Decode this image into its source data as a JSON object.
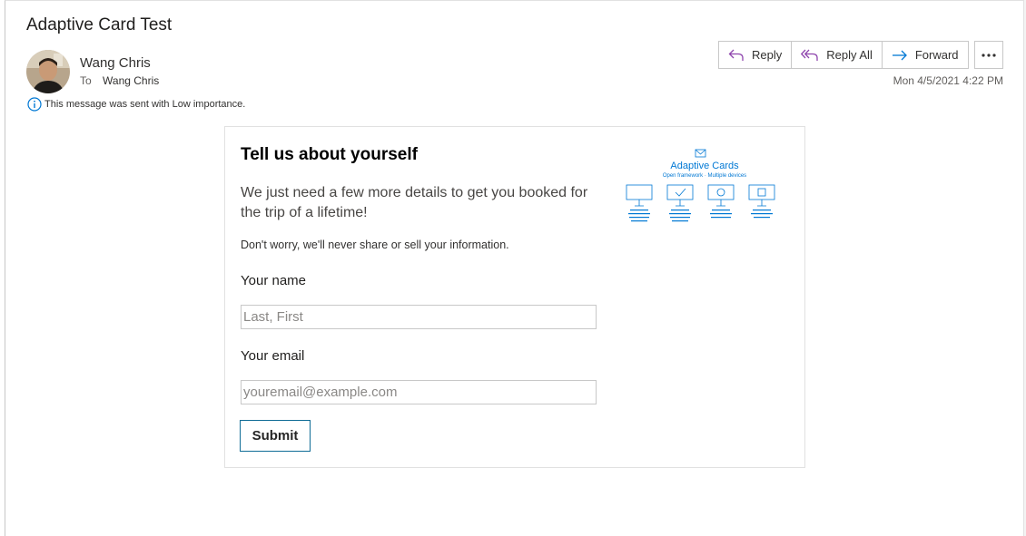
{
  "message": {
    "subject": "Adaptive Card Test",
    "sender": "Wang Chris",
    "to_label": "To",
    "to_name": "Wang Chris",
    "importance_note": "This message was sent with Low importance.",
    "timestamp": "Mon 4/5/2021 4:22 PM"
  },
  "toolbar": {
    "reply_label": "Reply",
    "reply_all_label": "Reply All",
    "forward_label": "Forward",
    "more_label": "•••"
  },
  "card": {
    "title": "Tell us about yourself",
    "subtitle": "We just need a few more details to get you booked for the trip of a lifetime!",
    "note": "Don't worry, we'll never share or sell your information.",
    "name_label": "Your name",
    "name_value": "",
    "name_placeholder": "Last, First",
    "email_label": "Your email",
    "email_value": "",
    "email_placeholder": "youremail@example.com",
    "submit_label": "Submit",
    "hero": {
      "title": "Adaptive Cards",
      "subtitle": "Open framework · Multiple devices"
    }
  },
  "colors": {
    "accent": "#0f6c96",
    "reply_icon": "#8e44ad",
    "forward_icon": "#0078d4",
    "info_icon": "#0078d4"
  }
}
